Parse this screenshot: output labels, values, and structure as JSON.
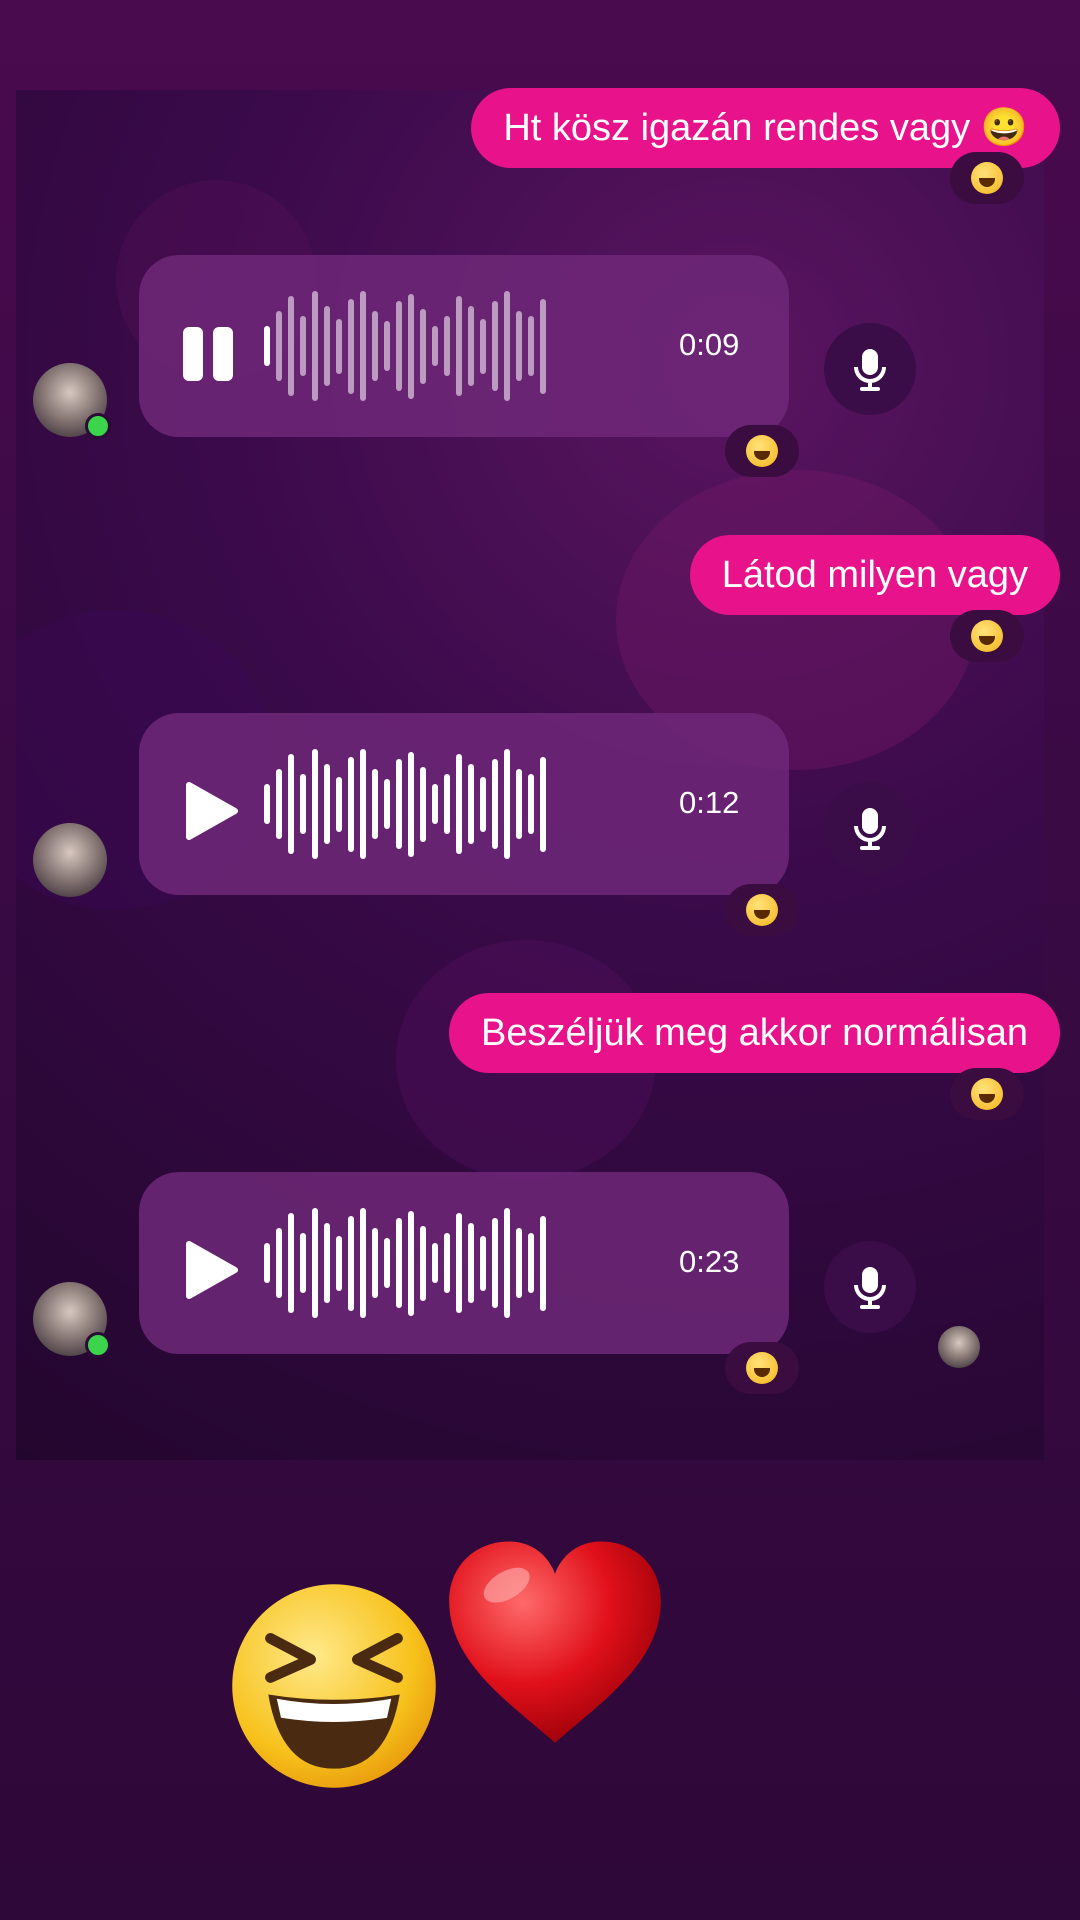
{
  "messages": {
    "out1": {
      "text": "Ht kösz igazán rendes vagy 😀"
    },
    "voice1": {
      "time": "0:09",
      "state": "pause-icon"
    },
    "out2": {
      "text": "Látod milyen vagy"
    },
    "voice2": {
      "time": "0:12",
      "state": "play-icon"
    },
    "out3": {
      "text": "Beszéljük meg akkor normálisan"
    },
    "voice3": {
      "time": "0:23",
      "state": "play-icon"
    }
  },
  "reaction_icon": "laughing-emoji-icon",
  "overlay_stickers": [
    "laughing-emoji-icon",
    "red-heart-icon"
  ],
  "colors": {
    "outgoing_bubble": "#e8128a",
    "voice_bubble": "#6e2878",
    "online_dot": "#3bd44a"
  }
}
